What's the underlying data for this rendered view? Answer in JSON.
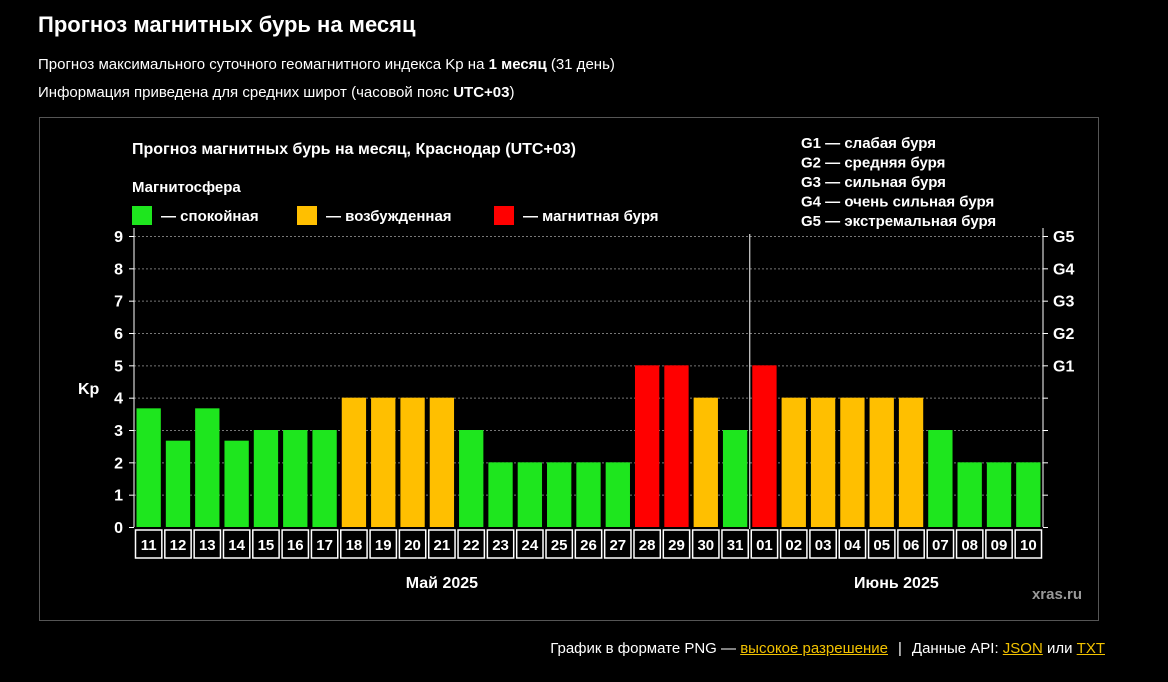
{
  "page": {
    "title": "Прогноз магнитных бурь на месяц",
    "subtitle1": {
      "pre": "Прогноз максимального суточного геомагнитного индекса Kp на ",
      "bold": "1 месяц",
      "post": " (31 день)"
    },
    "subtitle2": {
      "pre": "Информация приведена для средних широт (часовой пояс ",
      "bold": "UTC+03",
      "post": ")"
    }
  },
  "footer": {
    "png_text": "График в формате PNG — ",
    "png_link": "высокое разрешение",
    "separator": "|",
    "api_text": "Данные API: ",
    "json_link": "JSON",
    "or_text": " или ",
    "txt_link": "TXT"
  },
  "chart_data": {
    "type": "bar",
    "title": "Прогноз магнитных бурь на месяц, Краснодар (UTC+03)",
    "ylabel": "Kp",
    "ylim": [
      0,
      9
    ],
    "yticks": [
      0,
      1,
      2,
      3,
      4,
      5,
      6,
      7,
      8,
      9
    ],
    "right_ticks": [
      {
        "value": 5,
        "label": "G1"
      },
      {
        "value": 6,
        "label": "G2"
      },
      {
        "value": 7,
        "label": "G3"
      },
      {
        "value": 8,
        "label": "G4"
      },
      {
        "value": 9,
        "label": "G5"
      }
    ],
    "legend_title": "Магнитосфера",
    "legend": [
      {
        "label": "— спокойная",
        "color": "#1ee61e"
      },
      {
        "label": "— возбужденная",
        "color": "#ffbf00"
      },
      {
        "label": "— магнитная буря",
        "color": "#ff0000"
      }
    ],
    "storm_scale": [
      "G1 — слабая буря",
      "G2 — средняя буря",
      "G3 — сильная буря",
      "G4 — очень сильная буря",
      "G5 — экстремальная буря"
    ],
    "categories": [
      "11",
      "12",
      "13",
      "14",
      "15",
      "16",
      "17",
      "18",
      "19",
      "20",
      "21",
      "22",
      "23",
      "24",
      "25",
      "26",
      "27",
      "28",
      "29",
      "30",
      "31",
      "01",
      "02",
      "03",
      "04",
      "05",
      "06",
      "07",
      "08",
      "09",
      "10"
    ],
    "values": [
      3.67,
      2.67,
      3.67,
      2.67,
      3,
      3,
      3,
      4,
      4,
      4,
      4,
      3,
      2,
      2,
      2,
      2,
      2,
      5,
      5,
      4,
      3,
      5,
      4,
      4,
      4,
      4,
      4,
      3,
      2,
      2,
      2
    ],
    "months": [
      {
        "label": "Май 2025",
        "start": 0,
        "end": 20
      },
      {
        "label": "Июнь 2025",
        "start": 21,
        "end": 30
      }
    ],
    "watermark": "xras.ru",
    "colors": {
      "quiet": "#1ee61e",
      "active": "#ffbf00",
      "storm": "#ff0000"
    }
  }
}
